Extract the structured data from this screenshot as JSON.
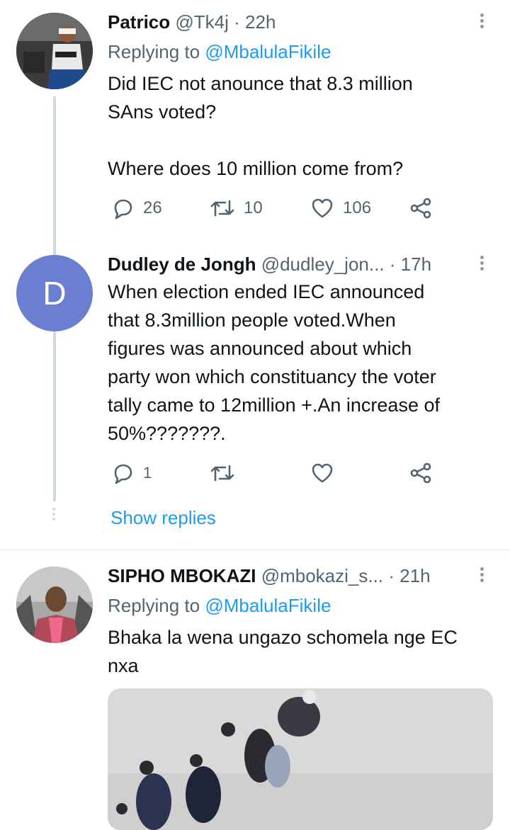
{
  "tweets": [
    {
      "name": "Patrico",
      "handle": "@Tk4j",
      "time": "· 22h",
      "replying_prefix": "Replying to ",
      "replying_to": "@MbalulaFikile",
      "text": "Did IEC not anounce that 8.3 million\nSAns voted?\n\nWhere does 10 million come from?",
      "replies": "26",
      "retweets": "10",
      "likes": "106"
    },
    {
      "name": "Dudley de Jongh",
      "handle": "@dudley_jon...",
      "time": "· 17h",
      "avatar_letter": "D",
      "avatar_color": "#6a7fd0",
      "text": "When election ended IEC announced\nthat 8.3million people voted.When\nfigures was announced about which\nparty won which constituancy the voter\ntally came to 12million +.An increase of\n50%???????.",
      "replies": "1"
    },
    {
      "name": "SIPHO MBOKAZI",
      "handle": "@mbokazi_s...",
      "time": "· 21h",
      "replying_prefix": "Replying to ",
      "replying_to": "@MbalulaFikile",
      "text": "Bhaka la wena ungazo schomela nge EC\nnxa"
    }
  ],
  "show_replies": "Show replies",
  "colors": {
    "link": "#1d9bf0",
    "muted": "#536471",
    "thread_line": "#cfd9de"
  }
}
